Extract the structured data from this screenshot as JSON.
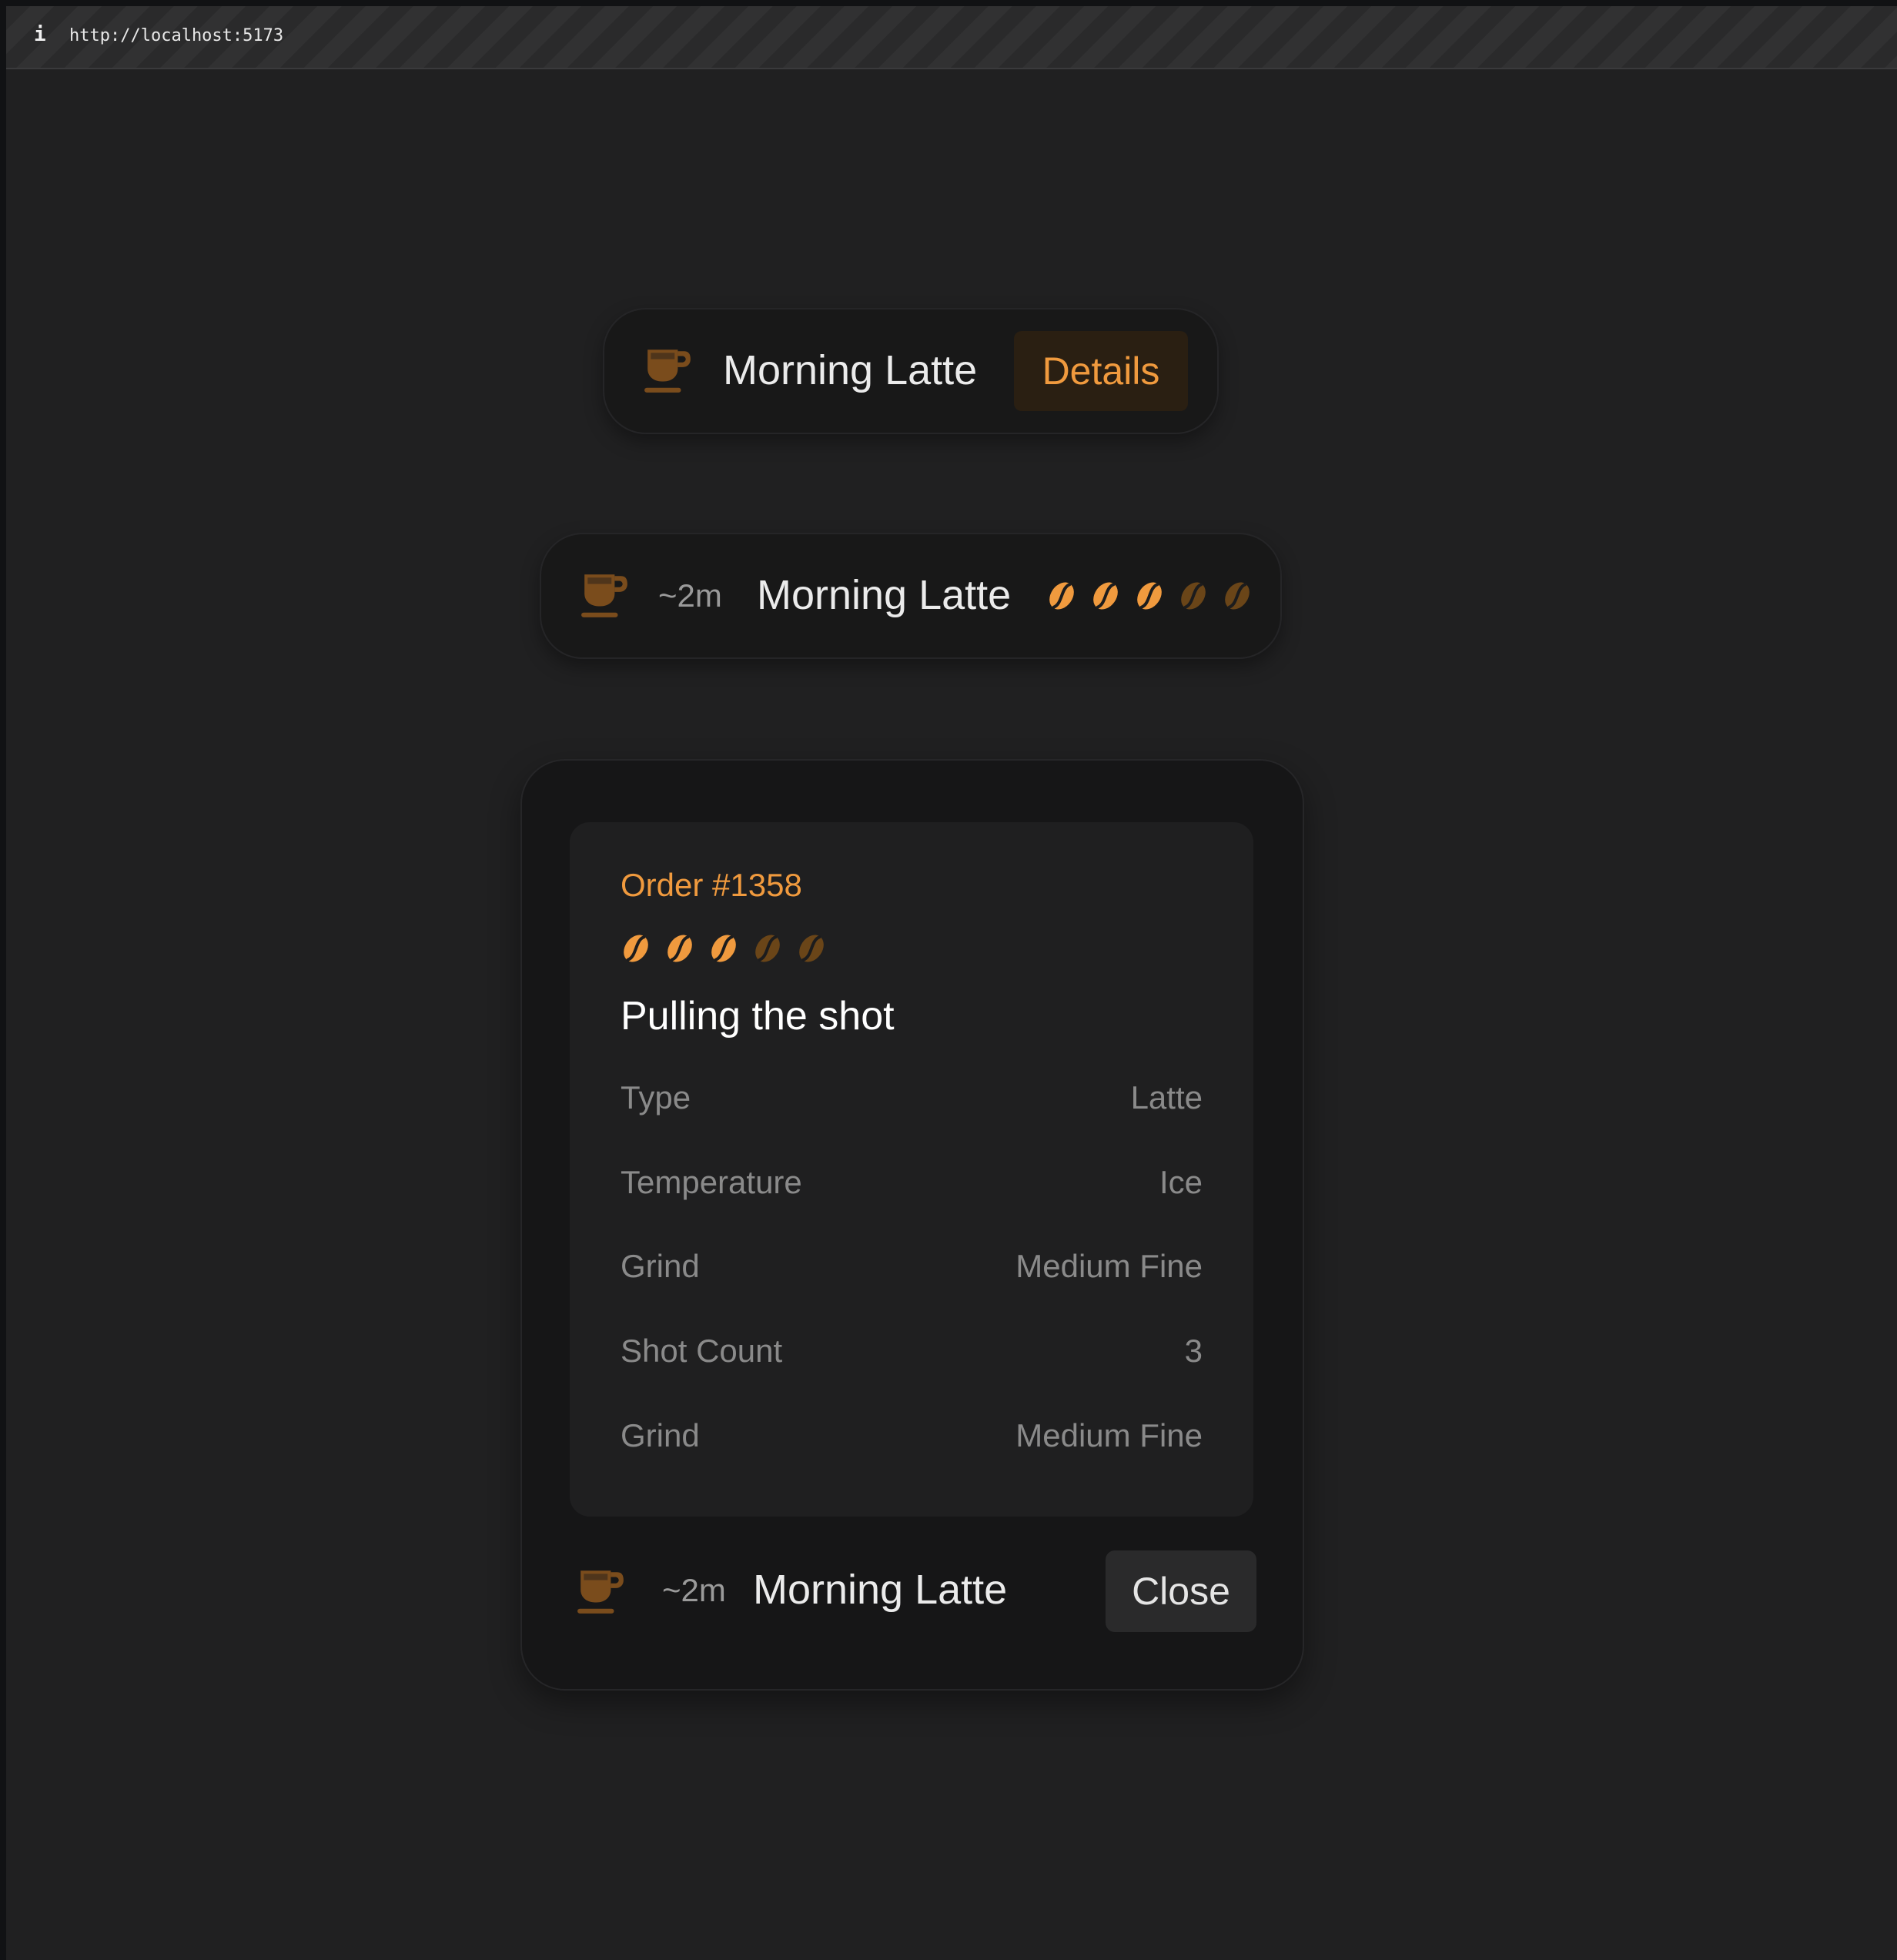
{
  "browser": {
    "info_icon": "i",
    "url": "http://localhost:5173"
  },
  "colors": {
    "accent": "#f09a3e",
    "bean_dim": "#6a4518",
    "cup": "#7a4c1c"
  },
  "compact_pill": {
    "icon": "coffee-cup-icon",
    "title": "Morning Latte",
    "details_label": "Details"
  },
  "expanded_pill": {
    "icon": "coffee-cup-icon",
    "eta": "~2m",
    "title": "Morning Latte",
    "strength": {
      "filled": 3,
      "total": 5
    }
  },
  "order_modal": {
    "order_number": "Order #1358",
    "strength": {
      "filled": 3,
      "total": 5
    },
    "status": "Pulling the shot",
    "details": [
      {
        "label": "Type",
        "value": "Latte"
      },
      {
        "label": "Temperature",
        "value": "Ice"
      },
      {
        "label": "Grind",
        "value": "Medium Fine"
      },
      {
        "label": "Shot Count",
        "value": "3"
      },
      {
        "label": "Grind",
        "value": "Medium Fine"
      }
    ],
    "footer": {
      "icon": "coffee-cup-icon",
      "eta": "~2m",
      "title": "Morning Latte",
      "close_label": "Close"
    }
  }
}
